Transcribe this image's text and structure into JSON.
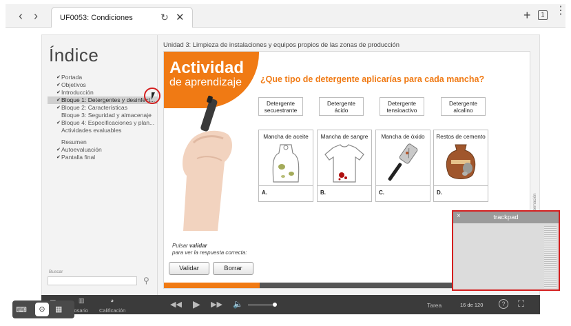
{
  "browser": {
    "tab_title": "UF0053: Condiciones",
    "back_icon": "chevron-left-icon",
    "forward_icon": "chevron-right-icon",
    "tab_count": "1"
  },
  "course": {
    "unit_title": "Unidad 3: Limpieza de instalaciones y equipos propios de las zonas de producción",
    "index_title": "Índice",
    "index_items": [
      {
        "label": "Portada",
        "checked": true
      },
      {
        "label": "Objetivos",
        "checked": true
      },
      {
        "label": "Introducción",
        "checked": true
      },
      {
        "label": "Bloque 1: Detergentes y desinfect...",
        "checked": true,
        "active": true
      },
      {
        "label": "Bloque 2: Características",
        "checked": true
      },
      {
        "label": "Bloque 3: Seguridad y almacenaje",
        "checked": false
      },
      {
        "label": "Bloque 4: Especificaciones y plan...",
        "checked": true
      },
      {
        "label": "Actividades evaluables",
        "checked": false
      },
      {
        "label": "Resumen",
        "checked": false
      },
      {
        "label": "Autoevaluación",
        "checked": true
      },
      {
        "label": "Pantalla final",
        "checked": true
      }
    ],
    "search_label": "Buscar",
    "search_placeholder": ""
  },
  "activity": {
    "title_line1": "Actividad",
    "title_line2": "de aprendizaje",
    "question": "¿Que tipo de detergente aplicarías para cada mancha?",
    "detergents": [
      {
        "line1": "Detergente",
        "line2": "secuestrante"
      },
      {
        "line1": "Detergente",
        "line2": "ácido"
      },
      {
        "line1": "Detergente",
        "line2": "tensioactivo"
      },
      {
        "line1": "Detergente",
        "line2": "alcalino"
      }
    ],
    "stains": [
      {
        "label": "Mancha de aceite",
        "letter": "A."
      },
      {
        "label": "Mancha de sangre",
        "letter": "B."
      },
      {
        "label": "Mancha de óxido",
        "letter": "C."
      },
      {
        "label": "Restos de cemento",
        "letter": "D."
      }
    ],
    "hint_prefix": "Pulsar ",
    "hint_bold": "validar",
    "hint_rest": "para ver la respuesta correcta:",
    "validate_label": "Validar",
    "clear_label": "Borrar",
    "progress_fraction": 0.26,
    "copyright": "© ITEM Formación"
  },
  "trackpad": {
    "title": "trackpad",
    "close_glyph": "×"
  },
  "player": {
    "glossary_label": "Glosario",
    "grade_label": "Calificación",
    "task_label": "Tarea",
    "page_label": "16 de 120",
    "help_glyph": "?"
  },
  "colors": {
    "accent": "#f07a14",
    "player_bg": "#3b3b3b",
    "highlight": "#d41f1f"
  }
}
